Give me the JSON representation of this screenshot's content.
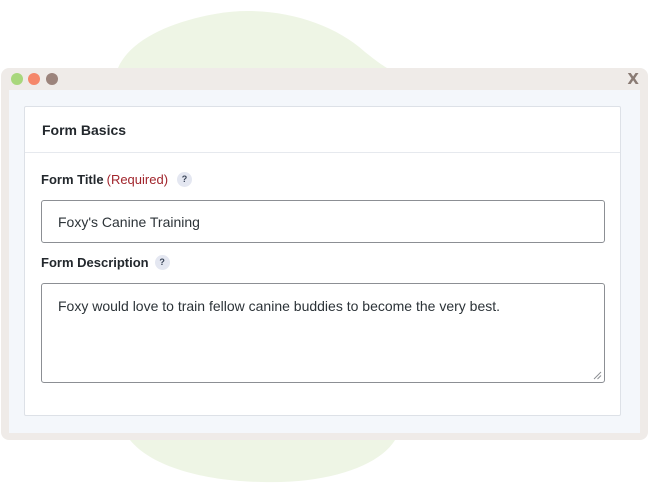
{
  "window": {
    "close_label": "X",
    "dot_colors": [
      "#a8d77c",
      "#f5876a",
      "#9c847c"
    ]
  },
  "card": {
    "title": "Form Basics"
  },
  "form_title": {
    "label": "Form Title",
    "required_label": "(Required)",
    "help_label": "?",
    "value": "Foxy's Canine Training"
  },
  "form_description": {
    "label": "Form Description",
    "help_label": "?",
    "value": "Foxy would love to train fellow canine buddies to become the very best."
  },
  "colors": {
    "required": "#a1252c",
    "blob": "#eef5e5",
    "window_frame": "#efebe8",
    "content_bg": "#f4f7fb"
  }
}
